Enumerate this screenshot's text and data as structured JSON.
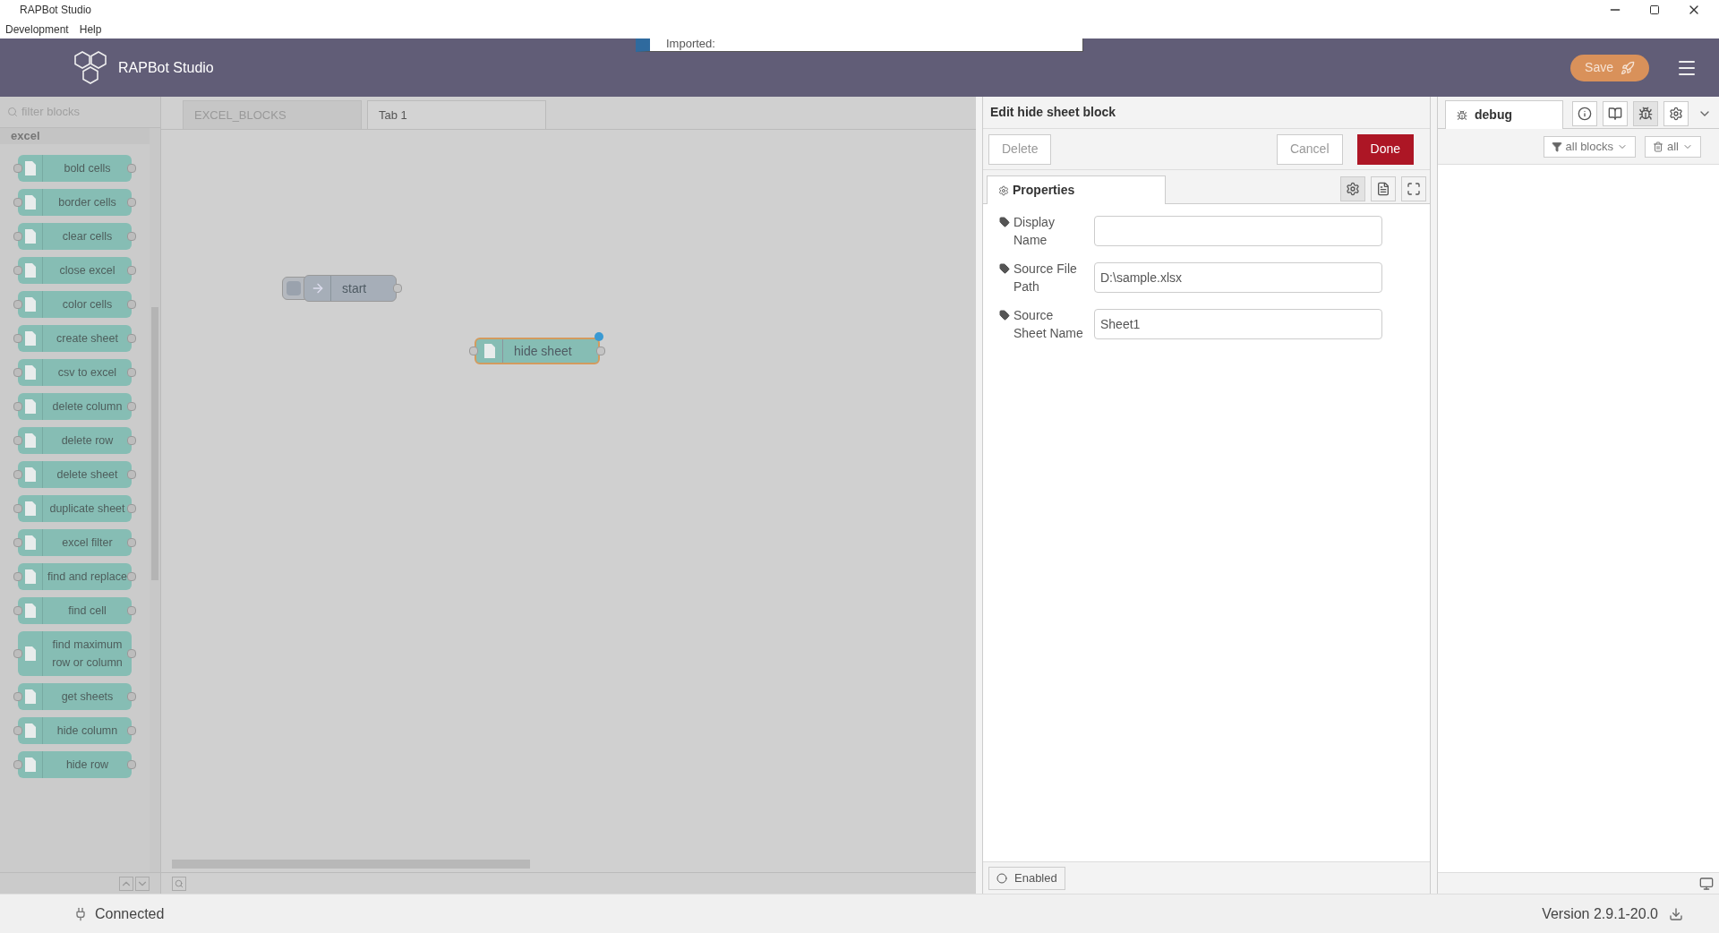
{
  "window": {
    "title": "RAPBot Studio"
  },
  "menu": [
    "Development",
    "Help"
  ],
  "header": {
    "title": "RAPBot Studio",
    "notification": "Imported:",
    "save_button": "Save"
  },
  "palette": {
    "filter": {
      "placeholder": "filter blocks"
    },
    "category": "excel",
    "blocks": [
      {
        "label": "bold cells"
      },
      {
        "label": "border cells"
      },
      {
        "label": "clear cells"
      },
      {
        "label": "close excel"
      },
      {
        "label": "color cells"
      },
      {
        "label": "create sheet"
      },
      {
        "label": "csv to excel"
      },
      {
        "label": "delete column"
      },
      {
        "label": "delete row"
      },
      {
        "label": "delete sheet"
      },
      {
        "label": "duplicate sheet"
      },
      {
        "label": "excel filter"
      },
      {
        "label": "find and replace"
      },
      {
        "label": "find cell"
      },
      {
        "label": "find maximum row or column"
      },
      {
        "label": "get sheets"
      },
      {
        "label": "hide column"
      },
      {
        "label": "hide row"
      }
    ]
  },
  "workspace": {
    "tabs": [
      {
        "label": "EXCEL_BLOCKS",
        "selected": false
      },
      {
        "label": "Tab 1",
        "selected": true
      }
    ],
    "nodes": [
      {
        "kind": "inject",
        "label": "start",
        "selected": false,
        "changed": false
      },
      {
        "kind": "file",
        "label": "hide sheet",
        "selected": true,
        "changed": true
      }
    ]
  },
  "editor": {
    "title": "Edit hide sheet block",
    "buttons": {
      "delete": "Delete",
      "cancel": "Cancel",
      "done": "Done"
    },
    "tab": "Properties",
    "fields": [
      {
        "label": "Display Name"
      },
      {
        "label": "Source File Path",
        "value": "D:\\sample.xlsx"
      },
      {
        "label": "Source Sheet Name",
        "value": "Sheet1"
      }
    ],
    "enabled": "Enabled"
  },
  "sidebar": {
    "tab": "debug",
    "filter": "all blocks",
    "clear": "all"
  },
  "status_bar": {
    "connection": "Connected",
    "version": "Version 2.9.1-20.0"
  }
}
